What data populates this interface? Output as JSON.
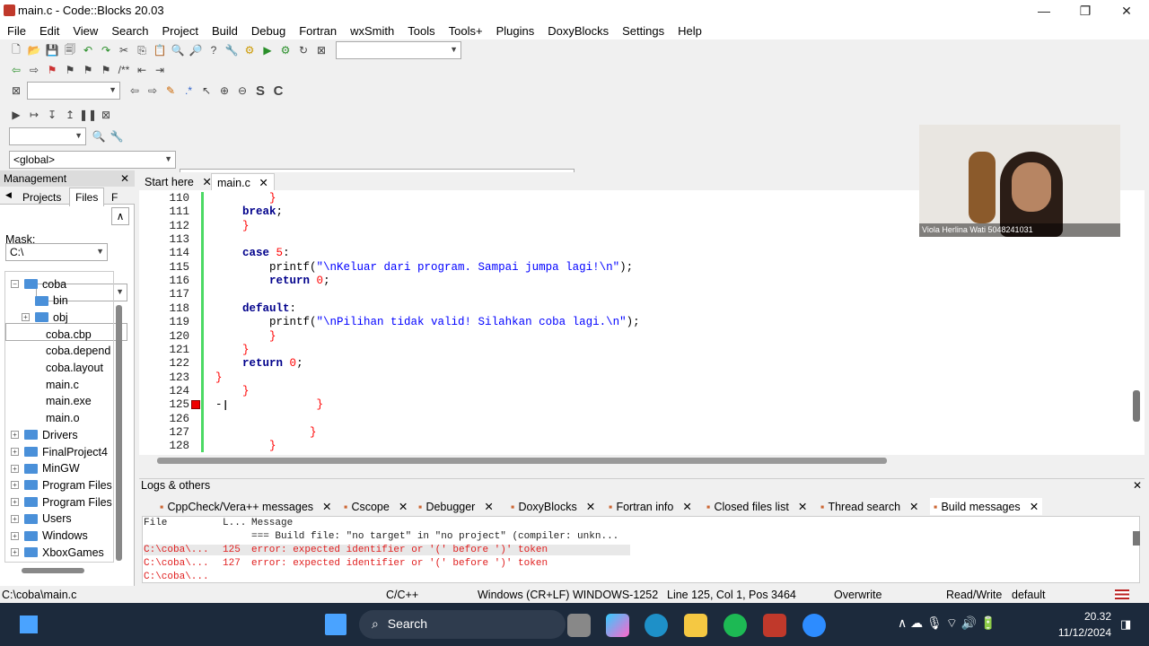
{
  "window": {
    "title": "main.c - Code::Blocks 20.03",
    "min": "—",
    "max": "❐",
    "close": "✕"
  },
  "menu": [
    "File",
    "Edit",
    "View",
    "Search",
    "Project",
    "Build",
    "Debug",
    "Fortran",
    "wxSmith",
    "Tools",
    "Tools+",
    "Plugins",
    "DoxyBlocks",
    "Settings",
    "Help"
  ],
  "scope": {
    "left": "<global>",
    "right": ""
  },
  "management": {
    "title": "Management",
    "close": "✕",
    "tab_projects": "Projects",
    "tab_files": "Files",
    "tab_more": "F",
    "path": "C:\\",
    "mask_label": "Mask:",
    "mask_value": ""
  },
  "tree": [
    {
      "label": "coba",
      "level": 0,
      "type": "folder",
      "expand": "−"
    },
    {
      "label": "bin",
      "level": 1,
      "type": "folder",
      "expand": ""
    },
    {
      "label": "obj",
      "level": 1,
      "type": "folder",
      "expand": "+"
    },
    {
      "label": "coba.cbp",
      "level": 1,
      "type": "file"
    },
    {
      "label": "coba.depend",
      "level": 1,
      "type": "file"
    },
    {
      "label": "coba.layout",
      "level": 1,
      "type": "file"
    },
    {
      "label": "main.c",
      "level": 1,
      "type": "file"
    },
    {
      "label": "main.exe",
      "level": 1,
      "type": "file"
    },
    {
      "label": "main.o",
      "level": 1,
      "type": "file"
    },
    {
      "label": "Drivers",
      "level": 0,
      "type": "folder",
      "expand": "+"
    },
    {
      "label": "FinalProject4",
      "level": 0,
      "type": "folder",
      "expand": "+"
    },
    {
      "label": "MinGW",
      "level": 0,
      "type": "folder",
      "expand": "+"
    },
    {
      "label": "Program Files",
      "level": 0,
      "type": "folder",
      "expand": "+"
    },
    {
      "label": "Program Files (:",
      "level": 0,
      "type": "folder",
      "expand": "+"
    },
    {
      "label": "Users",
      "level": 0,
      "type": "folder",
      "expand": "+"
    },
    {
      "label": "Windows",
      "level": 0,
      "type": "folder",
      "expand": "+"
    },
    {
      "label": "XboxGames",
      "level": 0,
      "type": "folder",
      "expand": "+"
    }
  ],
  "editor_tabs": [
    {
      "label": "Start here",
      "close": "✕"
    },
    {
      "label": "main.c",
      "close": "✕"
    }
  ],
  "code_lines": [
    {
      "n": "110",
      "html": "        <span class='br'>}</span>"
    },
    {
      "n": "111",
      "html": "    <span class='kw'>break</span>;"
    },
    {
      "n": "112",
      "html": "    <span class='br'>}</span>"
    },
    {
      "n": "113",
      "html": ""
    },
    {
      "n": "114",
      "html": "    <span class='kw'>case</span> <span class='num'>5</span>:"
    },
    {
      "n": "115",
      "html": "        printf(<span class='str'>\"\\nKeluar dari program. Sampai jumpa lagi!\\n\"</span>);"
    },
    {
      "n": "116",
      "html": "        <span class='kw'>return</span> <span class='num'>0</span>;"
    },
    {
      "n": "117",
      "html": ""
    },
    {
      "n": "118",
      "html": "    <span class='kw'>default</span>:"
    },
    {
      "n": "119",
      "html": "        printf(<span class='str'>\"\\nPilihan tidak valid! Silahkan coba lagi.\\n\"</span>);"
    },
    {
      "n": "120",
      "html": "        <span class='br'>}</span>"
    },
    {
      "n": "121",
      "html": "    <span class='br'>}</span>"
    },
    {
      "n": "122",
      "html": "    <span class='kw'>return</span> <span class='num'>0</span>;"
    },
    {
      "n": "123",
      "html": "<span class='br'>}</span>"
    },
    {
      "n": "124",
      "html": "    <span class='br'>}</span>"
    },
    {
      "n": "125",
      "html": "-              <span class='br'>}</span>"
    },
    {
      "n": "126",
      "html": ""
    },
    {
      "n": "127",
      "html": "              <span class='br'>}</span>"
    },
    {
      "n": "128",
      "html": "        <span class='br'>}</span>"
    }
  ],
  "logs": {
    "title": "Logs & others",
    "close": "✕",
    "tabs": [
      {
        "label": "CppCheck/Vera++ messages"
      },
      {
        "label": "Cscope"
      },
      {
        "label": "Debugger"
      },
      {
        "label": "DoxyBlocks"
      },
      {
        "label": "Fortran info"
      },
      {
        "label": "Closed files list"
      },
      {
        "label": "Thread search"
      },
      {
        "label": "Build messages"
      }
    ],
    "tab_close": "✕",
    "headers": {
      "file": "File",
      "line": "L...",
      "message": "Message"
    },
    "rows": [
      {
        "file": "",
        "line": "",
        "message": "=== Build file: \"no target\" in \"no project\" (compiler: unkn...",
        "error": false
      },
      {
        "file": "C:\\coba\\...",
        "line": "125",
        "message": "error: expected identifier or '(' before ')' token",
        "error": true
      },
      {
        "file": "C:\\coba\\...",
        "line": "127",
        "message": "error: expected identifier or '(' before ')' token",
        "error": true
      },
      {
        "file": "C:\\coba\\...",
        "line": "128",
        "message": "error: expected identifier or '(' before ')' token",
        "error": true
      }
    ]
  },
  "status": {
    "path": "C:\\coba\\main.c",
    "lang": "C/C++",
    "eol": "Windows (CR+LF)",
    "enc": "WINDOWS-1252",
    "pos": "Line 125, Col 1, Pos 3464",
    "mode": "Overwrite",
    "rw": "Read/Write",
    "profile": "default"
  },
  "webcam": {
    "name": "Viola Herlina Wati 5048241031"
  },
  "taskbar": {
    "search": "Search",
    "time": "20.32",
    "date": "11/12/2024"
  },
  "colors": {
    "accent": "#0078d4",
    "error": "#e02020",
    "changebar": "#4cd964"
  }
}
